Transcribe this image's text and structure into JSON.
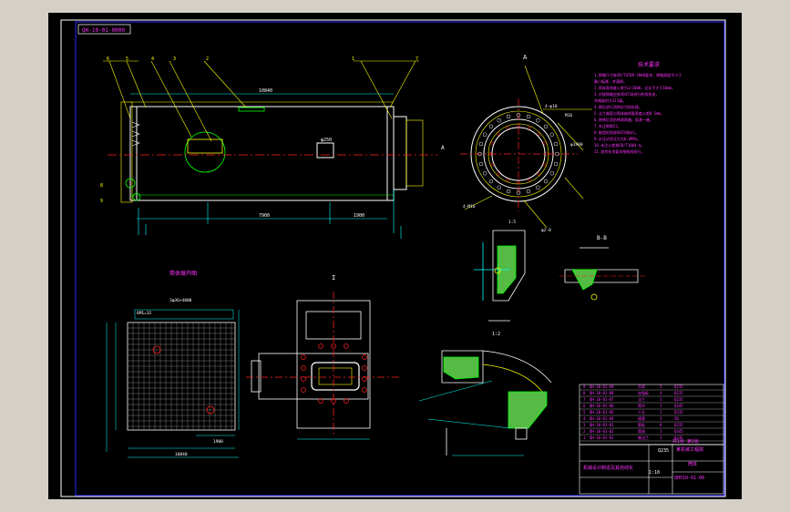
{
  "header": {
    "code_stamp": "QH-10-01-0000"
  },
  "views": {
    "flatten_title": "筒体展开图",
    "section_a": "A",
    "section_bb": "B-B",
    "section_i": "I",
    "section_marker": "A"
  },
  "dimensions": {
    "total_length": "10840",
    "lower_length": "7900",
    "right_length": "1900",
    "nozzle": "φ250"
  },
  "balloons": [
    "6",
    "5",
    "4",
    "3",
    "2",
    "1",
    "7",
    "8",
    "9"
  ],
  "flange": {
    "holes_note": "4-φ18",
    "bolt_note": "M16",
    "weld_note": "4-M16",
    "mark_note": "φ2-8",
    "diam_note": "φ1900",
    "scale": "1:5"
  },
  "notes": {
    "title": "技术要求",
    "lines": [
      "1.焊缝尺寸按JB/T4709-2000要求，焊缝高度不小于",
      "最小板厚，并满焊。",
      "2.筒体直线度公差为1/1000，全长不大于10mm。",
      "3.对接焊缝应按JB4730进行射线检测，",
      "合格级别为III级。",
      "4.焊后进行消除应力热处理。",
      "5.法兰端面与筒体轴线垂直度公差0.5mm。",
      "6.除锈后涂防锈漆两遍，面漆一遍。",
      "7.未注倒角C2。",
      "8.制造检验按GB150执行。",
      "9.水压试验压力为0.6MPa。",
      "10.未注公差按GB/T1804-m。",
      "11.其余技术要求按图纸执行。"
    ]
  },
  "sections": {
    "weld_scale": "1:2"
  },
  "flatten": {
    "top_dim": "3φ36×4800",
    "left_note": "6M1=32",
    "bottom_dim": "10840",
    "bottom_dim2": "1900"
  },
  "bom": [
    {
      "no": "9",
      "code": "QH-10-01-09",
      "name": "吊耳",
      "qty": "2",
      "mat": "Q235"
    },
    {
      "no": "8",
      "code": "QH-10-01-08",
      "name": "加强板",
      "qty": "4",
      "mat": "Q235"
    },
    {
      "no": "7",
      "code": "QH-10-01-07",
      "name": "法兰",
      "qty": "1",
      "mat": "Q235"
    },
    {
      "no": "6",
      "code": "QH-10-01-06",
      "name": "筒节",
      "qty": "1",
      "mat": "Q345"
    },
    {
      "no": "5",
      "code": "QH-10-01-05",
      "name": "人孔",
      "qty": "1",
      "mat": "Q235"
    },
    {
      "no": "4",
      "code": "QH-10-01-04",
      "name": "接管",
      "qty": "1",
      "mat": "20"
    },
    {
      "no": "3",
      "code": "QH-10-01-03",
      "name": "筋板",
      "qty": "8",
      "mat": "Q235"
    },
    {
      "no": "2",
      "code": "QH-10-01-02",
      "name": "筒体",
      "qty": "1",
      "mat": "Q345"
    },
    {
      "no": "1",
      "code": "QH-10-01-01",
      "name": "端法兰",
      "qty": "1",
      "mat": "Q235"
    }
  ],
  "title_block": {
    "company": "某机械工程院",
    "part_name": "筒体",
    "drawing_no": "QH510-01-00",
    "material": "Q235",
    "dept": "机械设计制造及其自动化",
    "scale": "1:10",
    "sheet_info": "共1张 第1张"
  }
}
